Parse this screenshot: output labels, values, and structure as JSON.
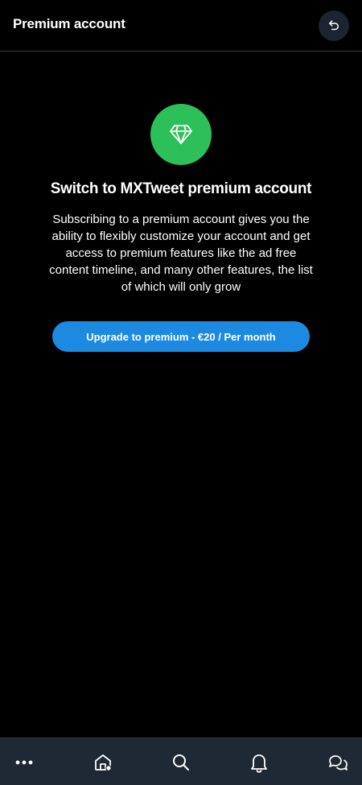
{
  "header": {
    "title": "Premium account",
    "back_icon": "undo-arrow-icon"
  },
  "main": {
    "badge_icon": "diamond-icon",
    "headline": "Switch to MXTweet premium account",
    "description": "Subscribing to a premium account gives you the ability to flexibly customize your account and get access to premium features like the ad free content timeline, and many other features, the list of which will only grow",
    "upgrade_button": "Upgrade to premium - €20 / Per month"
  },
  "bottom_nav": {
    "items": [
      {
        "name": "more",
        "icon": "more-dots-icon"
      },
      {
        "name": "home",
        "icon": "home-icon"
      },
      {
        "name": "search",
        "icon": "search-icon"
      },
      {
        "name": "notifications",
        "icon": "bell-icon"
      },
      {
        "name": "messages",
        "icon": "chat-bubbles-icon"
      }
    ]
  },
  "colors": {
    "background": "#000000",
    "badge_green": "#2dbf5a",
    "button_blue": "#1d8ae2",
    "nav_background": "#1e2935",
    "back_button_background": "#1b2430"
  }
}
